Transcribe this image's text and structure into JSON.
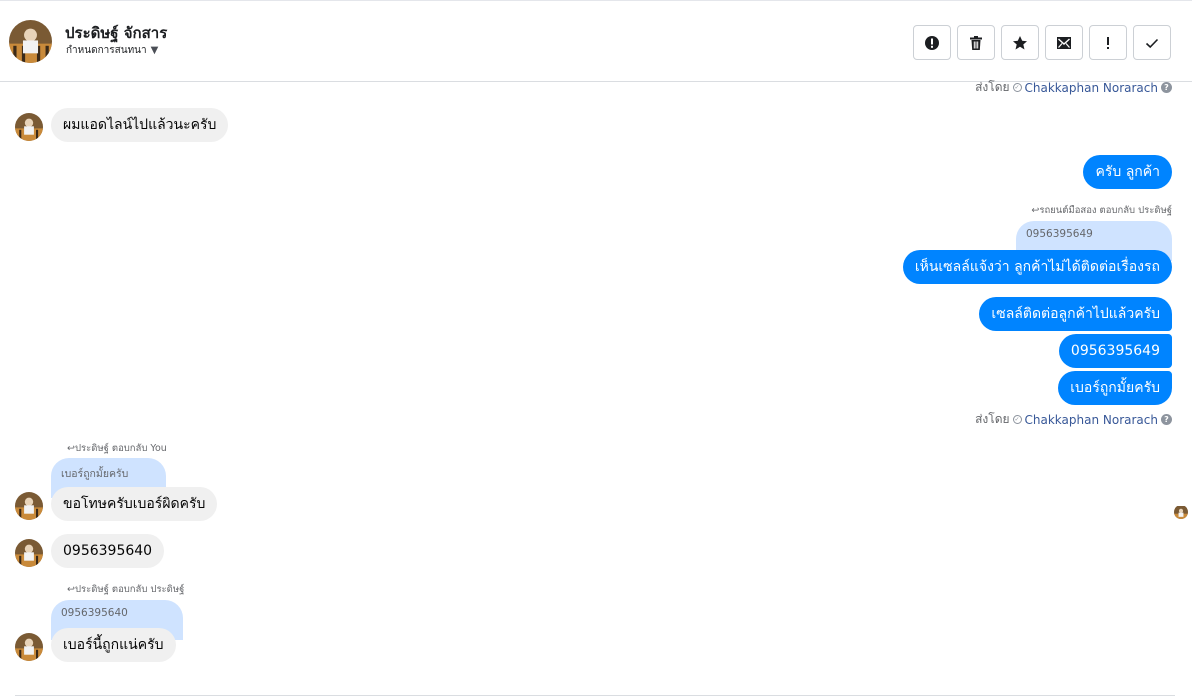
{
  "header": {
    "name": "ประดิษฐ์ จักสาร",
    "subtitle": "กำหนดการสนทนา",
    "actions": [
      {
        "icon": "alert-circle-icon",
        "name": "mark-spam-button"
      },
      {
        "icon": "trash-icon",
        "name": "delete-button"
      },
      {
        "icon": "star-icon",
        "name": "star-button"
      },
      {
        "icon": "mail-unread-icon",
        "name": "mark-unread-button"
      },
      {
        "icon": "exclamation-icon",
        "name": "follow-up-button"
      },
      {
        "icon": "checkmark-icon",
        "name": "mark-done-button"
      }
    ]
  },
  "sent_by_label": "ส่งโดย",
  "sender_name": "Chakkaphan Norarach",
  "help_glyph": "?",
  "messages": {
    "in1": "ผมแอดไลน์ไปแล้วนะครับ",
    "out1": "ครับ ลูกค้า",
    "out2_reply_meta": "รถยนต์มือสอง ตอบกลับ ประดิษฐ์",
    "out2_quote": "0956395649",
    "out2": "เห็นเซลล์แจ้งว่า ลูกค้าไม่ได้ติดต่อเรื่องรถ",
    "out3": "เซลล์ติดต่อลูกค้าไปแล้วครับ",
    "out4": "0956395649",
    "out5": "เบอร์ถูกมั้ยครับ",
    "in2_reply_meta": "ประดิษฐ์ ตอบกลับ You",
    "in2_quote": "เบอร์ถูกมั้ยครับ",
    "in2": "ขอโทษครับเบอร์ผิดครับ",
    "in3": "0956395640",
    "in4_reply_meta": "ประดิษฐ์ ตอบกลับ ประดิษฐ์",
    "in4_quote": "0956395640",
    "in4": "เบอร์นี้ถูกแน่ครับ"
  },
  "colors": {
    "outgoing_bubble": "#0084ff",
    "incoming_bubble": "#f0f0f0",
    "quote_bubble": "#cfe3ff",
    "sender_link": "#385898"
  }
}
